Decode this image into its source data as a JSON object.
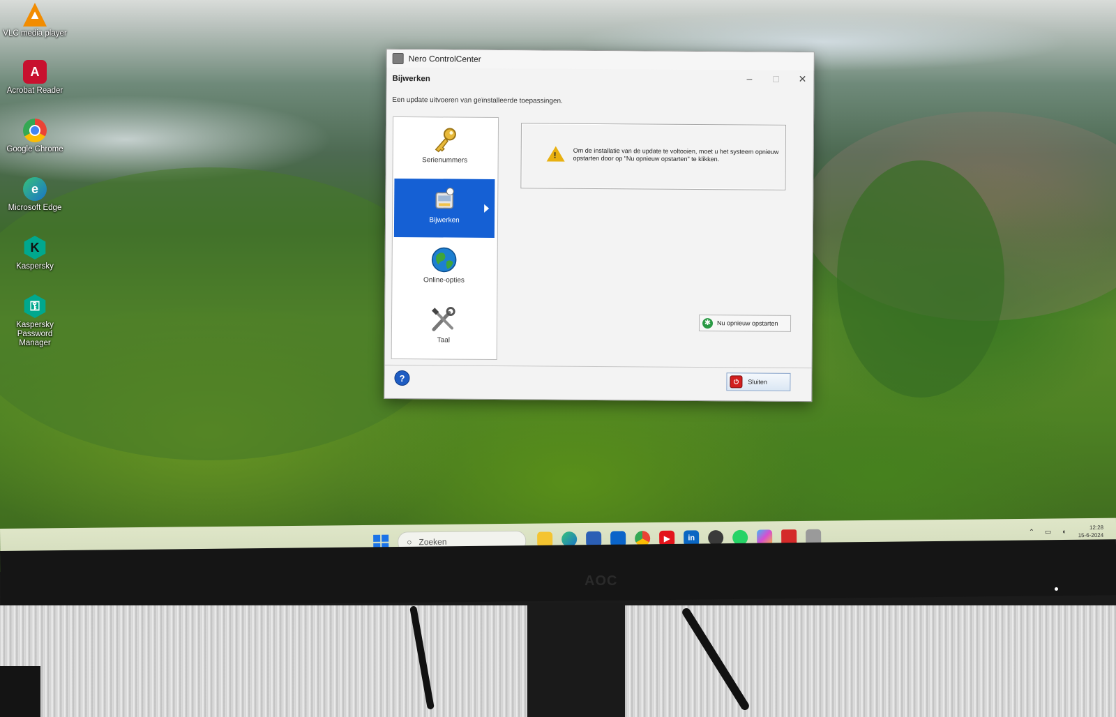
{
  "desktop": {
    "icons": [
      {
        "label": "VLC media player",
        "icon": "vlc-icon",
        "color": "#f28c00"
      },
      {
        "label": "Acrobat Reader",
        "icon": "acrobat-icon",
        "color": "#c8102e"
      },
      {
        "label": "Google Chrome",
        "icon": "chrome-icon",
        "color": "#4285f4"
      },
      {
        "label": "Microsoft Edge",
        "icon": "edge-icon",
        "color": "#1a9bd8"
      },
      {
        "label": "Kaspersky",
        "icon": "kaspersky-icon",
        "color": "#00a88e"
      },
      {
        "label": "Kaspersky Password Manager",
        "icon": "kaspersky-password-icon",
        "color": "#00a88e"
      }
    ]
  },
  "window": {
    "title": "Nero ControlCenter",
    "section_title": "Bijwerken",
    "section_subtitle": "Een update uitvoeren van geïnstalleerde toepassingen.",
    "controls": {
      "minimize": "–",
      "maximize": "□",
      "close": "✕"
    },
    "nav": [
      {
        "label": "Serienummers",
        "icon": "key-icon",
        "active": false
      },
      {
        "label": "Bijwerken",
        "icon": "update-icon",
        "active": true
      },
      {
        "label": "Online-opties",
        "icon": "globe-icon",
        "active": false
      },
      {
        "label": "Taal",
        "icon": "tools-icon",
        "active": false
      }
    ],
    "message": "Om de installatie van de update te voltooien, moet u het systeem opnieuw opstarten door op \"Nu opnieuw opstarten\" te klikken.",
    "restart_label": "Nu opnieuw opstarten",
    "help_label": "?",
    "close_label": "Sluiten",
    "accent": "#1560d4"
  },
  "taskbar": {
    "search_placeholder": "Zoeken",
    "apps": [
      "file-explorer-icon",
      "edge-icon",
      "store-icon",
      "outlook-icon",
      "chrome-icon",
      "youtube-icon",
      "linkedin-icon",
      "app-icon",
      "whatsapp-icon",
      "copilot-icon",
      "app-red-icon",
      "nero-icon"
    ],
    "linkedin_text": "in",
    "clock_time": "12:28",
    "clock_date": "15-6-2024"
  },
  "monitor": {
    "brand": "AOC"
  }
}
